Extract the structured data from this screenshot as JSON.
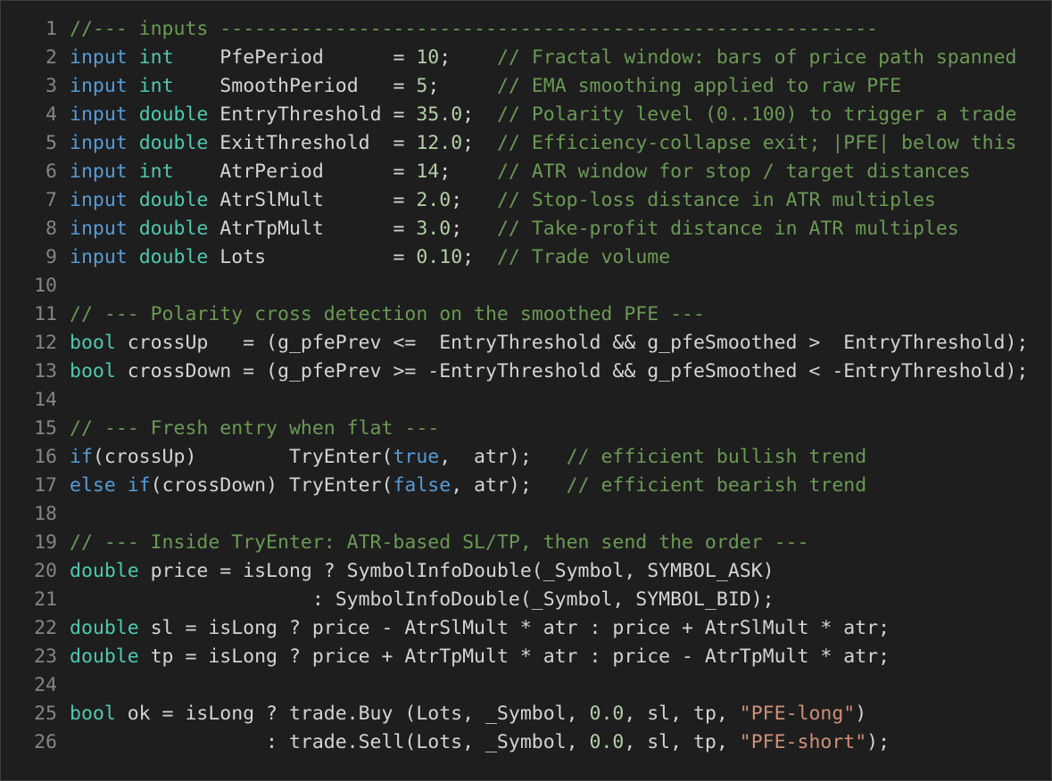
{
  "colors": {
    "background": "#1e1e1e",
    "line_number": "#858585",
    "kw": "#569cd6",
    "ty": "#4ec9b0",
    "id": "#d4d4d4",
    "num": "#b5cea8",
    "str": "#ce9178",
    "com": "#6a9955",
    "op": "#d4d4d4"
  },
  "lines": [
    {
      "n": "1",
      "tokens": [
        {
          "t": "//--- inputs ---------------------------------------------------------",
          "c": "com"
        }
      ]
    },
    {
      "n": "2",
      "tokens": [
        {
          "t": "input",
          "c": "kw"
        },
        {
          "t": " ",
          "c": "op"
        },
        {
          "t": "int",
          "c": "ty"
        },
        {
          "t": "    PfePeriod      = ",
          "c": "id"
        },
        {
          "t": "10",
          "c": "num"
        },
        {
          "t": ";    ",
          "c": "op"
        },
        {
          "t": "// Fractal window: bars of price path spanned",
          "c": "com"
        }
      ]
    },
    {
      "n": "3",
      "tokens": [
        {
          "t": "input",
          "c": "kw"
        },
        {
          "t": " ",
          "c": "op"
        },
        {
          "t": "int",
          "c": "ty"
        },
        {
          "t": "    SmoothPeriod   = ",
          "c": "id"
        },
        {
          "t": "5",
          "c": "num"
        },
        {
          "t": ";     ",
          "c": "op"
        },
        {
          "t": "// EMA smoothing applied to raw PFE",
          "c": "com"
        }
      ]
    },
    {
      "n": "4",
      "tokens": [
        {
          "t": "input",
          "c": "kw"
        },
        {
          "t": " ",
          "c": "op"
        },
        {
          "t": "double",
          "c": "ty"
        },
        {
          "t": " EntryThreshold = ",
          "c": "id"
        },
        {
          "t": "35.0",
          "c": "num"
        },
        {
          "t": ";  ",
          "c": "op"
        },
        {
          "t": "// Polarity level (0..100) to trigger a trade",
          "c": "com"
        }
      ]
    },
    {
      "n": "5",
      "tokens": [
        {
          "t": "input",
          "c": "kw"
        },
        {
          "t": " ",
          "c": "op"
        },
        {
          "t": "double",
          "c": "ty"
        },
        {
          "t": " ExitThreshold  = ",
          "c": "id"
        },
        {
          "t": "12.0",
          "c": "num"
        },
        {
          "t": ";  ",
          "c": "op"
        },
        {
          "t": "// Efficiency-collapse exit; |PFE| below this",
          "c": "com"
        }
      ]
    },
    {
      "n": "6",
      "tokens": [
        {
          "t": "input",
          "c": "kw"
        },
        {
          "t": " ",
          "c": "op"
        },
        {
          "t": "int",
          "c": "ty"
        },
        {
          "t": "    AtrPeriod      = ",
          "c": "id"
        },
        {
          "t": "14",
          "c": "num"
        },
        {
          "t": ";    ",
          "c": "op"
        },
        {
          "t": "// ATR window for stop / target distances",
          "c": "com"
        }
      ]
    },
    {
      "n": "7",
      "tokens": [
        {
          "t": "input",
          "c": "kw"
        },
        {
          "t": " ",
          "c": "op"
        },
        {
          "t": "double",
          "c": "ty"
        },
        {
          "t": " AtrSlMult      = ",
          "c": "id"
        },
        {
          "t": "2.0",
          "c": "num"
        },
        {
          "t": ";   ",
          "c": "op"
        },
        {
          "t": "// Stop-loss distance in ATR multiples",
          "c": "com"
        }
      ]
    },
    {
      "n": "8",
      "tokens": [
        {
          "t": "input",
          "c": "kw"
        },
        {
          "t": " ",
          "c": "op"
        },
        {
          "t": "double",
          "c": "ty"
        },
        {
          "t": " AtrTpMult      = ",
          "c": "id"
        },
        {
          "t": "3.0",
          "c": "num"
        },
        {
          "t": ";   ",
          "c": "op"
        },
        {
          "t": "// Take-profit distance in ATR multiples",
          "c": "com"
        }
      ]
    },
    {
      "n": "9",
      "tokens": [
        {
          "t": "input",
          "c": "kw"
        },
        {
          "t": " ",
          "c": "op"
        },
        {
          "t": "double",
          "c": "ty"
        },
        {
          "t": " Lots           = ",
          "c": "id"
        },
        {
          "t": "0.10",
          "c": "num"
        },
        {
          "t": ";  ",
          "c": "op"
        },
        {
          "t": "// Trade volume",
          "c": "com"
        }
      ]
    },
    {
      "n": "10",
      "tokens": []
    },
    {
      "n": "11",
      "tokens": [
        {
          "t": "// --- Polarity cross detection on the smoothed PFE ---",
          "c": "com"
        }
      ]
    },
    {
      "n": "12",
      "tokens": [
        {
          "t": "bool",
          "c": "ty"
        },
        {
          "t": " crossUp   = (g_pfePrev <=  EntryThreshold && g_pfeSmoothed >  EntryThreshold);",
          "c": "id"
        }
      ]
    },
    {
      "n": "13",
      "tokens": [
        {
          "t": "bool",
          "c": "ty"
        },
        {
          "t": " crossDown = (g_pfePrev >= -EntryThreshold && g_pfeSmoothed < -EntryThreshold);",
          "c": "id"
        }
      ]
    },
    {
      "n": "14",
      "tokens": []
    },
    {
      "n": "15",
      "tokens": [
        {
          "t": "// --- Fresh entry when flat ---",
          "c": "com"
        }
      ]
    },
    {
      "n": "16",
      "tokens": [
        {
          "t": "if",
          "c": "kw"
        },
        {
          "t": "(crossUp)        TryEnter(",
          "c": "id"
        },
        {
          "t": "true",
          "c": "kw"
        },
        {
          "t": ",  atr);   ",
          "c": "id"
        },
        {
          "t": "// efficient bullish trend",
          "c": "com"
        }
      ]
    },
    {
      "n": "17",
      "tokens": [
        {
          "t": "else",
          "c": "kw"
        },
        {
          "t": " ",
          "c": "op"
        },
        {
          "t": "if",
          "c": "kw"
        },
        {
          "t": "(crossDown) TryEnter(",
          "c": "id"
        },
        {
          "t": "false",
          "c": "kw"
        },
        {
          "t": ", atr);   ",
          "c": "id"
        },
        {
          "t": "// efficient bearish trend",
          "c": "com"
        }
      ]
    },
    {
      "n": "18",
      "tokens": []
    },
    {
      "n": "19",
      "tokens": [
        {
          "t": "// --- Inside TryEnter: ATR-based SL/TP, then send the order ---",
          "c": "com"
        }
      ]
    },
    {
      "n": "20",
      "tokens": [
        {
          "t": "double",
          "c": "ty"
        },
        {
          "t": " price = isLong ? SymbolInfoDouble(_Symbol, SYMBOL_ASK)",
          "c": "id"
        }
      ]
    },
    {
      "n": "21",
      "tokens": [
        {
          "t": "                     : SymbolInfoDouble(_Symbol, SYMBOL_BID);",
          "c": "id"
        }
      ]
    },
    {
      "n": "22",
      "tokens": [
        {
          "t": "double",
          "c": "ty"
        },
        {
          "t": " sl = isLong ? price - AtrSlMult * atr : price + AtrSlMult * atr;",
          "c": "id"
        }
      ]
    },
    {
      "n": "23",
      "tokens": [
        {
          "t": "double",
          "c": "ty"
        },
        {
          "t": " tp = isLong ? price + AtrTpMult * atr : price - AtrTpMult * atr;",
          "c": "id"
        }
      ]
    },
    {
      "n": "24",
      "tokens": []
    },
    {
      "n": "25",
      "tokens": [
        {
          "t": "bool",
          "c": "ty"
        },
        {
          "t": " ok = isLong ? trade.Buy (Lots, _Symbol, ",
          "c": "id"
        },
        {
          "t": "0.0",
          "c": "num"
        },
        {
          "t": ", sl, tp, ",
          "c": "id"
        },
        {
          "t": "\"PFE-long\"",
          "c": "str"
        },
        {
          "t": ")",
          "c": "id"
        }
      ]
    },
    {
      "n": "26",
      "tokens": [
        {
          "t": "                 : trade.Sell(Lots, _Symbol, ",
          "c": "id"
        },
        {
          "t": "0.0",
          "c": "num"
        },
        {
          "t": ", sl, tp, ",
          "c": "id"
        },
        {
          "t": "\"PFE-short\"",
          "c": "str"
        },
        {
          "t": ");",
          "c": "id"
        }
      ]
    }
  ]
}
